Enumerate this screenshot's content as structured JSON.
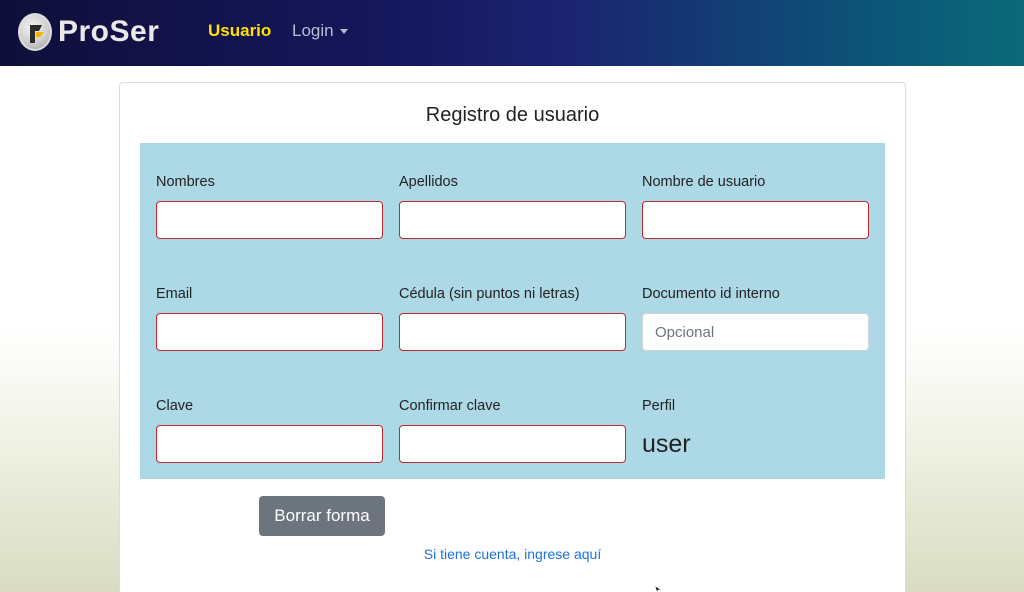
{
  "navbar": {
    "brand": "ProSer",
    "links": [
      {
        "label": "Usuario",
        "active": true
      },
      {
        "label": "Login",
        "dropdown": true
      }
    ]
  },
  "form": {
    "title": "Registro de usuario",
    "fields": {
      "nombres": {
        "label": "Nombres",
        "value": "",
        "placeholder": ""
      },
      "apellidos": {
        "label": "Apellidos",
        "value": "",
        "placeholder": ""
      },
      "nombre_usuario": {
        "label": "Nombre de usuario",
        "value": "",
        "placeholder": ""
      },
      "email": {
        "label": "Email",
        "value": "",
        "placeholder": ""
      },
      "cedula": {
        "label": "Cédula (sin puntos ni letras)",
        "value": "",
        "placeholder": ""
      },
      "documento_id": {
        "label": "Documento id interno",
        "value": "",
        "placeholder": "Opcional"
      },
      "clave": {
        "label": "Clave",
        "value": "",
        "placeholder": ""
      },
      "confirmar_clave": {
        "label": "Confirmar clave",
        "value": "",
        "placeholder": ""
      },
      "perfil": {
        "label": "Perfil",
        "value": "user"
      }
    },
    "reset_button": "Borrar forma",
    "login_link": "Si tiene cuenta, ingrese aquí"
  },
  "colors": {
    "accent_nav_active": "#ffe100",
    "form_background": "#add8e6",
    "invalid_border": "#c0292f",
    "link": "#1a73d9",
    "button_secondary": "#6c757d"
  }
}
